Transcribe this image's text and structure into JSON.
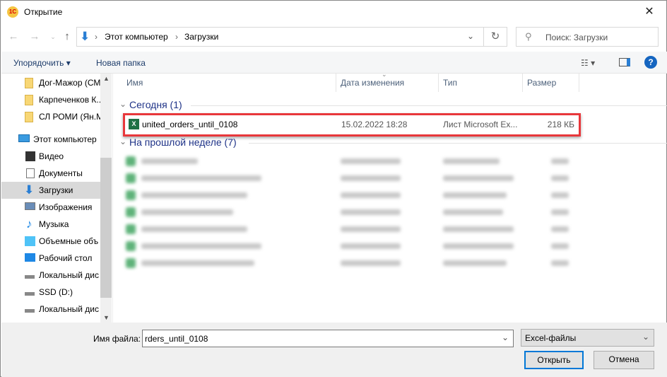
{
  "window": {
    "title": "Открытие",
    "logo": "1С"
  },
  "address": {
    "crumbs": [
      "Этот компьютер",
      "Загрузки"
    ]
  },
  "search": {
    "placeholder": "Поиск: Загрузки"
  },
  "toolbar": {
    "organize": "Упорядочить",
    "new_folder": "Новая папка"
  },
  "sidebar": {
    "items": [
      {
        "label": "Дог-Мажор (СМ",
        "icon": "folder-icon"
      },
      {
        "label": "Карпеченков К..",
        "icon": "folder-icon"
      },
      {
        "label": "СЛ РОМИ (Ян.М",
        "icon": "folder-icon"
      },
      {
        "label": "Этот компьютер",
        "icon": "computer-icon"
      },
      {
        "label": "Видео",
        "icon": "video-icon"
      },
      {
        "label": "Документы",
        "icon": "documents-icon"
      },
      {
        "label": "Загрузки",
        "icon": "downloads-icon",
        "selected": true
      },
      {
        "label": "Изображения",
        "icon": "pictures-icon"
      },
      {
        "label": "Музыка",
        "icon": "music-icon"
      },
      {
        "label": "Объемные объ",
        "icon": "3d-objects-icon"
      },
      {
        "label": "Рабочий стол",
        "icon": "desktop-icon"
      },
      {
        "label": "Локальный дис",
        "icon": "drive-icon"
      },
      {
        "label": "SSD (D:)",
        "icon": "drive-icon"
      },
      {
        "label": "Локальный дис",
        "icon": "drive-icon"
      }
    ]
  },
  "columns": {
    "name": "Имя",
    "date": "Дата изменения",
    "type": "Тип",
    "size": "Размер"
  },
  "groups": {
    "today": "Сегодня (1)",
    "last_week": "На прошлой неделе (7)"
  },
  "file": {
    "name": "united_orders_until_0108",
    "date": "15.02.2022 18:28",
    "type": "Лист Microsoft Ex...",
    "size": "218 КБ"
  },
  "footer": {
    "filename_label": "Имя файла:",
    "filename_value": "rders_until_0108",
    "filetype": "Excel-файлы",
    "open": "Открыть",
    "cancel": "Отмена"
  },
  "colors": {
    "highlight": "#e8373b",
    "accent": "#0078d7",
    "group": "#1e3287"
  }
}
